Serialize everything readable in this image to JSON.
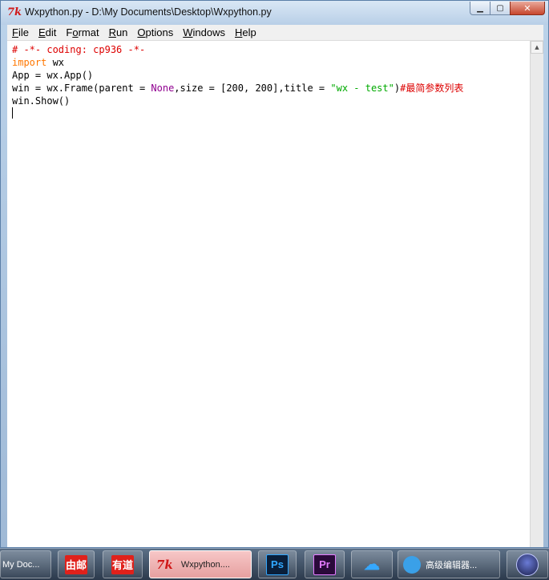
{
  "window": {
    "title": "Wxpython.py - D:\\My Documents\\Desktop\\Wxpython.py",
    "app_icon_text": "7k",
    "buttons": {
      "minimize": "▁",
      "maximize": "▢",
      "close": "✕"
    }
  },
  "menu": [
    {
      "ul": "F",
      "rest": "ile"
    },
    {
      "ul": "E",
      "rest": "dit"
    },
    {
      "ul": "",
      "pre": "F",
      "ul2": "o",
      "rest": "rmat"
    },
    {
      "ul": "R",
      "rest": "un"
    },
    {
      "ul": "O",
      "rest": "ptions"
    },
    {
      "ul": "W",
      "rest": "indows"
    },
    {
      "ul": "H",
      "rest": "elp"
    }
  ],
  "menu_labels": {
    "file_u": "F",
    "file_r": "ile",
    "edit_u": "E",
    "edit_r": "dit",
    "format_p": "F",
    "format_u": "o",
    "format_r": "rmat",
    "run_u": "R",
    "run_r": "un",
    "options_u": "O",
    "options_r": "ptions",
    "windows_u": "W",
    "windows_r": "indows",
    "help_u": "H",
    "help_r": "elp"
  },
  "code": {
    "line1": "# -*- coding: cp936 -*-",
    "line2_kw": "import",
    "line2_rest": " wx",
    "line3": "App = wx.App()",
    "line4_a": "win = wx.Frame(parent = ",
    "line4_none": "None",
    "line4_b": ",size = [200, 200],title = ",
    "line4_str": "\"wx - test\"",
    "line4_b2": ")",
    "line4_comment": "#最简参数列表",
    "line5": "win.Show()"
  },
  "taskbar": {
    "item0": "My Doc...",
    "item1_icon": "由邮",
    "item2_icon": "有道",
    "item3_icon": "7k",
    "item3_label": "Wxpython....",
    "item4_icon": "Ps",
    "item5_icon": "Pr",
    "item6_icon": "☁",
    "item7_label": "高级编辑器..."
  },
  "colors": {
    "keyword": "#ff7700",
    "comment": "#dd0000",
    "string": "#00aa00",
    "builtin": "#900090"
  }
}
